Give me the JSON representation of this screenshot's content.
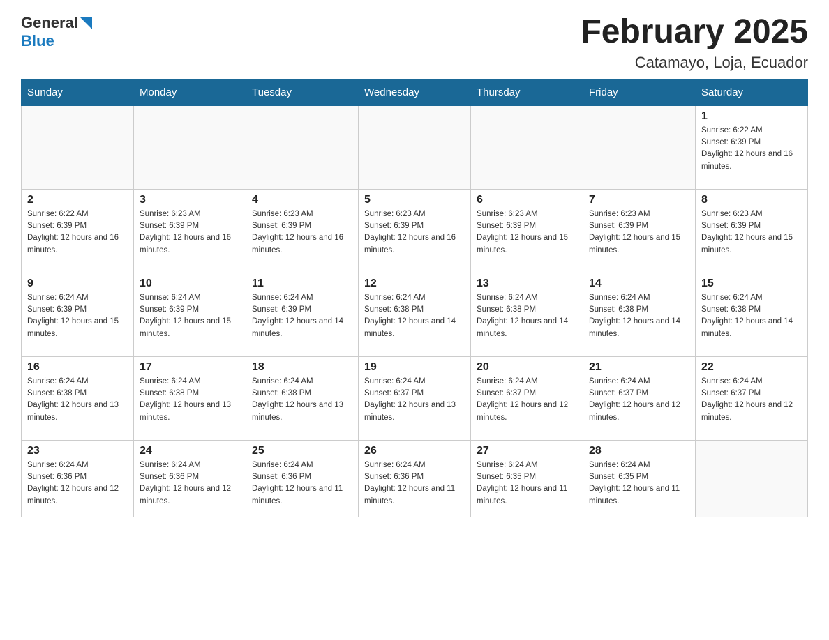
{
  "header": {
    "logo": {
      "general": "General",
      "blue": "Blue"
    },
    "title": "February 2025",
    "location": "Catamayo, Loja, Ecuador"
  },
  "days_of_week": [
    "Sunday",
    "Monday",
    "Tuesday",
    "Wednesday",
    "Thursday",
    "Friday",
    "Saturday"
  ],
  "weeks": [
    [
      {
        "day": "",
        "info": []
      },
      {
        "day": "",
        "info": []
      },
      {
        "day": "",
        "info": []
      },
      {
        "day": "",
        "info": []
      },
      {
        "day": "",
        "info": []
      },
      {
        "day": "",
        "info": []
      },
      {
        "day": "1",
        "info": [
          "Sunrise: 6:22 AM",
          "Sunset: 6:39 PM",
          "Daylight: 12 hours and 16 minutes."
        ]
      }
    ],
    [
      {
        "day": "2",
        "info": [
          "Sunrise: 6:22 AM",
          "Sunset: 6:39 PM",
          "Daylight: 12 hours and 16 minutes."
        ]
      },
      {
        "day": "3",
        "info": [
          "Sunrise: 6:23 AM",
          "Sunset: 6:39 PM",
          "Daylight: 12 hours and 16 minutes."
        ]
      },
      {
        "day": "4",
        "info": [
          "Sunrise: 6:23 AM",
          "Sunset: 6:39 PM",
          "Daylight: 12 hours and 16 minutes."
        ]
      },
      {
        "day": "5",
        "info": [
          "Sunrise: 6:23 AM",
          "Sunset: 6:39 PM",
          "Daylight: 12 hours and 16 minutes."
        ]
      },
      {
        "day": "6",
        "info": [
          "Sunrise: 6:23 AM",
          "Sunset: 6:39 PM",
          "Daylight: 12 hours and 15 minutes."
        ]
      },
      {
        "day": "7",
        "info": [
          "Sunrise: 6:23 AM",
          "Sunset: 6:39 PM",
          "Daylight: 12 hours and 15 minutes."
        ]
      },
      {
        "day": "8",
        "info": [
          "Sunrise: 6:23 AM",
          "Sunset: 6:39 PM",
          "Daylight: 12 hours and 15 minutes."
        ]
      }
    ],
    [
      {
        "day": "9",
        "info": [
          "Sunrise: 6:24 AM",
          "Sunset: 6:39 PM",
          "Daylight: 12 hours and 15 minutes."
        ]
      },
      {
        "day": "10",
        "info": [
          "Sunrise: 6:24 AM",
          "Sunset: 6:39 PM",
          "Daylight: 12 hours and 15 minutes."
        ]
      },
      {
        "day": "11",
        "info": [
          "Sunrise: 6:24 AM",
          "Sunset: 6:39 PM",
          "Daylight: 12 hours and 14 minutes."
        ]
      },
      {
        "day": "12",
        "info": [
          "Sunrise: 6:24 AM",
          "Sunset: 6:38 PM",
          "Daylight: 12 hours and 14 minutes."
        ]
      },
      {
        "day": "13",
        "info": [
          "Sunrise: 6:24 AM",
          "Sunset: 6:38 PM",
          "Daylight: 12 hours and 14 minutes."
        ]
      },
      {
        "day": "14",
        "info": [
          "Sunrise: 6:24 AM",
          "Sunset: 6:38 PM",
          "Daylight: 12 hours and 14 minutes."
        ]
      },
      {
        "day": "15",
        "info": [
          "Sunrise: 6:24 AM",
          "Sunset: 6:38 PM",
          "Daylight: 12 hours and 14 minutes."
        ]
      }
    ],
    [
      {
        "day": "16",
        "info": [
          "Sunrise: 6:24 AM",
          "Sunset: 6:38 PM",
          "Daylight: 12 hours and 13 minutes."
        ]
      },
      {
        "day": "17",
        "info": [
          "Sunrise: 6:24 AM",
          "Sunset: 6:38 PM",
          "Daylight: 12 hours and 13 minutes."
        ]
      },
      {
        "day": "18",
        "info": [
          "Sunrise: 6:24 AM",
          "Sunset: 6:38 PM",
          "Daylight: 12 hours and 13 minutes."
        ]
      },
      {
        "day": "19",
        "info": [
          "Sunrise: 6:24 AM",
          "Sunset: 6:37 PM",
          "Daylight: 12 hours and 13 minutes."
        ]
      },
      {
        "day": "20",
        "info": [
          "Sunrise: 6:24 AM",
          "Sunset: 6:37 PM",
          "Daylight: 12 hours and 12 minutes."
        ]
      },
      {
        "day": "21",
        "info": [
          "Sunrise: 6:24 AM",
          "Sunset: 6:37 PM",
          "Daylight: 12 hours and 12 minutes."
        ]
      },
      {
        "day": "22",
        "info": [
          "Sunrise: 6:24 AM",
          "Sunset: 6:37 PM",
          "Daylight: 12 hours and 12 minutes."
        ]
      }
    ],
    [
      {
        "day": "23",
        "info": [
          "Sunrise: 6:24 AM",
          "Sunset: 6:36 PM",
          "Daylight: 12 hours and 12 minutes."
        ]
      },
      {
        "day": "24",
        "info": [
          "Sunrise: 6:24 AM",
          "Sunset: 6:36 PM",
          "Daylight: 12 hours and 12 minutes."
        ]
      },
      {
        "day": "25",
        "info": [
          "Sunrise: 6:24 AM",
          "Sunset: 6:36 PM",
          "Daylight: 12 hours and 11 minutes."
        ]
      },
      {
        "day": "26",
        "info": [
          "Sunrise: 6:24 AM",
          "Sunset: 6:36 PM",
          "Daylight: 12 hours and 11 minutes."
        ]
      },
      {
        "day": "27",
        "info": [
          "Sunrise: 6:24 AM",
          "Sunset: 6:35 PM",
          "Daylight: 12 hours and 11 minutes."
        ]
      },
      {
        "day": "28",
        "info": [
          "Sunrise: 6:24 AM",
          "Sunset: 6:35 PM",
          "Daylight: 12 hours and 11 minutes."
        ]
      },
      {
        "day": "",
        "info": []
      }
    ]
  ]
}
